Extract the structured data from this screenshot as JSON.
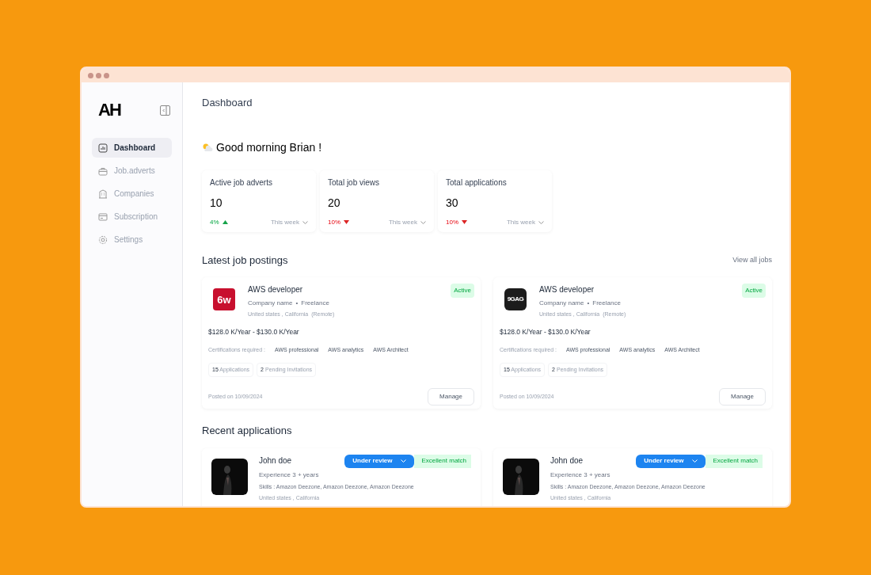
{
  "logo": {
    "text": "AH"
  },
  "sidebar": {
    "items": [
      {
        "label": "Dashboard",
        "selected": true
      },
      {
        "label": "Job.adverts",
        "selected": false
      },
      {
        "label": "Companies",
        "selected": false
      },
      {
        "label": "Subscription",
        "selected": false
      },
      {
        "label": "Settings",
        "selected": false
      }
    ]
  },
  "header": {
    "title": "Dashboard"
  },
  "greeting": "Good morning Brian !",
  "stats": [
    {
      "label": "Active job adverts",
      "value": "10",
      "change": "4%",
      "kind": "up",
      "period": "This week"
    },
    {
      "label": "Total job views",
      "value": "20",
      "change": "10%",
      "kind": "down",
      "period": "This week"
    },
    {
      "label": "Total applications",
      "value": "30",
      "change": "10%",
      "kind": "down",
      "period": "This week"
    }
  ],
  "latest_jobs": {
    "title": "Latest job postings",
    "link": "View all jobs",
    "cards": [
      {
        "logo_text": "6w",
        "color": "#c8102e",
        "title": "AWS developer",
        "company": "Company name",
        "separator": "•",
        "type": "Freelance",
        "location": "United states , California  (Remote)",
        "status": "Active",
        "salary": "$128.0 K/Year - $130.0 K/Year",
        "cert_label": "Certifications required :",
        "certs": [
          "AWS professional",
          "AWS analytics",
          "AWS Architect"
        ],
        "applications_count": "15",
        "applications_label": "Applications",
        "invitations_count": "2",
        "invitations_label": "Pending Invitations",
        "posted": "Posted on 10/09/2024",
        "button": "Manage"
      },
      {
        "logo_text": "9GAG",
        "color": "#1c1c1c",
        "title": "AWS developer",
        "company": "Company name",
        "separator": "•",
        "type": "Freelance",
        "location": "United states , California  (Remote)",
        "status": "Active",
        "salary": "$128.0 K/Year - $130.0 K/Year",
        "cert_label": "Certifications required :",
        "certs": [
          "AWS professional",
          "AWS analytics",
          "AWS Architect"
        ],
        "applications_count": "15",
        "applications_label": "Applications",
        "invitations_count": "2",
        "invitations_label": "Pending Invitations",
        "posted": "Posted on 10/09/2024",
        "button": "Manage"
      }
    ]
  },
  "recent_applications": {
    "title": "Recent applications",
    "cards": [
      {
        "name": "John doe",
        "experience": "Experience 3 + years",
        "skills": "Skills : Amazon Deezone, Amazon Deezone, Amazon Deezone",
        "location": "United states , California",
        "status": "Under review",
        "match": "Excellent match"
      },
      {
        "name": "John doe",
        "experience": "Experience 3 + years",
        "skills": "Skills : Amazon Deezone, Amazon Deezone, Amazon Deezone",
        "location": "United states , California",
        "status": "Under review",
        "match": "Excellent match"
      }
    ]
  }
}
